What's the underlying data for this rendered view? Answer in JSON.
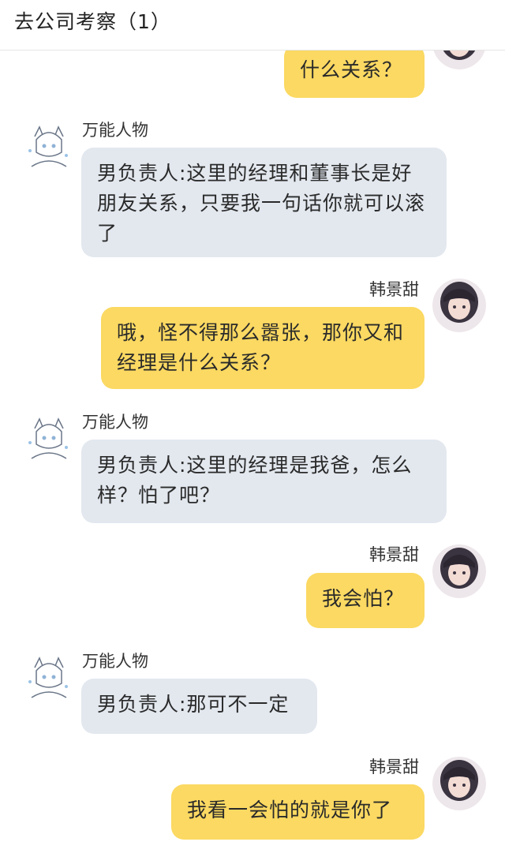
{
  "header": {
    "title": "去公司考察（1）"
  },
  "contacts": {
    "other": {
      "name": "万能人物",
      "avatar_icon": "anime-boy-avatar-icon"
    },
    "me": {
      "name": "韩景甜",
      "avatar_icon": "girl-photo-avatar-icon"
    }
  },
  "messages": [
    {
      "from": "me",
      "text": "什么关系？"
    },
    {
      "from": "other",
      "name": "万能人物",
      "text": "男负责人:这里的经理和董事长是好朋友关系，只要我一句话你就可以滚了"
    },
    {
      "from": "me",
      "name": "韩景甜",
      "text": "哦，怪不得那么嚣张，那你又和经理是什么关系？"
    },
    {
      "from": "other",
      "name": "万能人物",
      "text": "男负责人:这里的经理是我爸，怎么样？怕了吧？"
    },
    {
      "from": "me",
      "name": "韩景甜",
      "text": "我会怕？"
    },
    {
      "from": "other",
      "name": "万能人物",
      "text": "男负责人:那可不一定"
    },
    {
      "from": "me",
      "name": "韩景甜",
      "text": "我看一会怕的就是你了"
    }
  ],
  "colors": {
    "left_bubble": "#e3e8ef",
    "right_bubble": "#fbd962",
    "background": "#ffffff"
  }
}
